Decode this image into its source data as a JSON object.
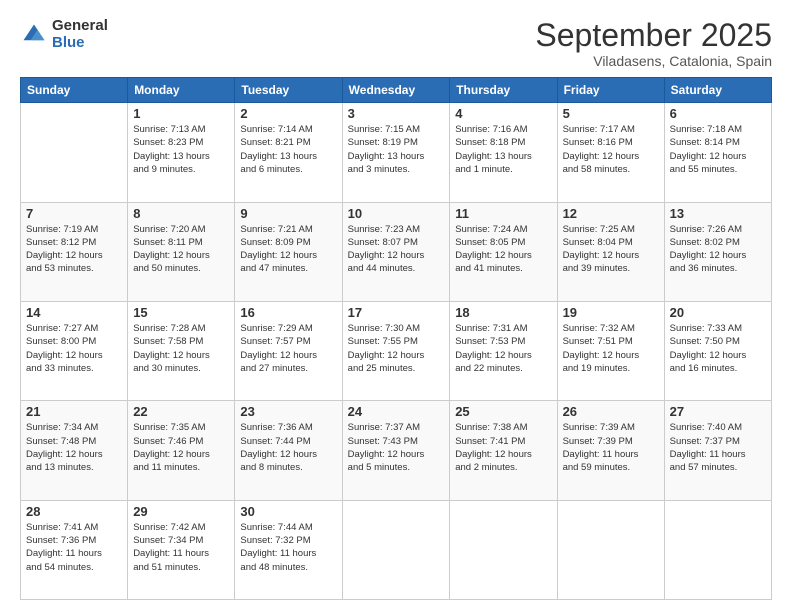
{
  "logo": {
    "general": "General",
    "blue": "Blue"
  },
  "title": "September 2025",
  "location": "Viladasens, Catalonia, Spain",
  "days_of_week": [
    "Sunday",
    "Monday",
    "Tuesday",
    "Wednesday",
    "Thursday",
    "Friday",
    "Saturday"
  ],
  "weeks": [
    [
      {
        "day": "",
        "info": ""
      },
      {
        "day": "1",
        "info": "Sunrise: 7:13 AM\nSunset: 8:23 PM\nDaylight: 13 hours\nand 9 minutes."
      },
      {
        "day": "2",
        "info": "Sunrise: 7:14 AM\nSunset: 8:21 PM\nDaylight: 13 hours\nand 6 minutes."
      },
      {
        "day": "3",
        "info": "Sunrise: 7:15 AM\nSunset: 8:19 PM\nDaylight: 13 hours\nand 3 minutes."
      },
      {
        "day": "4",
        "info": "Sunrise: 7:16 AM\nSunset: 8:18 PM\nDaylight: 13 hours\nand 1 minute."
      },
      {
        "day": "5",
        "info": "Sunrise: 7:17 AM\nSunset: 8:16 PM\nDaylight: 12 hours\nand 58 minutes."
      },
      {
        "day": "6",
        "info": "Sunrise: 7:18 AM\nSunset: 8:14 PM\nDaylight: 12 hours\nand 55 minutes."
      }
    ],
    [
      {
        "day": "7",
        "info": "Sunrise: 7:19 AM\nSunset: 8:12 PM\nDaylight: 12 hours\nand 53 minutes."
      },
      {
        "day": "8",
        "info": "Sunrise: 7:20 AM\nSunset: 8:11 PM\nDaylight: 12 hours\nand 50 minutes."
      },
      {
        "day": "9",
        "info": "Sunrise: 7:21 AM\nSunset: 8:09 PM\nDaylight: 12 hours\nand 47 minutes."
      },
      {
        "day": "10",
        "info": "Sunrise: 7:23 AM\nSunset: 8:07 PM\nDaylight: 12 hours\nand 44 minutes."
      },
      {
        "day": "11",
        "info": "Sunrise: 7:24 AM\nSunset: 8:05 PM\nDaylight: 12 hours\nand 41 minutes."
      },
      {
        "day": "12",
        "info": "Sunrise: 7:25 AM\nSunset: 8:04 PM\nDaylight: 12 hours\nand 39 minutes."
      },
      {
        "day": "13",
        "info": "Sunrise: 7:26 AM\nSunset: 8:02 PM\nDaylight: 12 hours\nand 36 minutes."
      }
    ],
    [
      {
        "day": "14",
        "info": "Sunrise: 7:27 AM\nSunset: 8:00 PM\nDaylight: 12 hours\nand 33 minutes."
      },
      {
        "day": "15",
        "info": "Sunrise: 7:28 AM\nSunset: 7:58 PM\nDaylight: 12 hours\nand 30 minutes."
      },
      {
        "day": "16",
        "info": "Sunrise: 7:29 AM\nSunset: 7:57 PM\nDaylight: 12 hours\nand 27 minutes."
      },
      {
        "day": "17",
        "info": "Sunrise: 7:30 AM\nSunset: 7:55 PM\nDaylight: 12 hours\nand 25 minutes."
      },
      {
        "day": "18",
        "info": "Sunrise: 7:31 AM\nSunset: 7:53 PM\nDaylight: 12 hours\nand 22 minutes."
      },
      {
        "day": "19",
        "info": "Sunrise: 7:32 AM\nSunset: 7:51 PM\nDaylight: 12 hours\nand 19 minutes."
      },
      {
        "day": "20",
        "info": "Sunrise: 7:33 AM\nSunset: 7:50 PM\nDaylight: 12 hours\nand 16 minutes."
      }
    ],
    [
      {
        "day": "21",
        "info": "Sunrise: 7:34 AM\nSunset: 7:48 PM\nDaylight: 12 hours\nand 13 minutes."
      },
      {
        "day": "22",
        "info": "Sunrise: 7:35 AM\nSunset: 7:46 PM\nDaylight: 12 hours\nand 11 minutes."
      },
      {
        "day": "23",
        "info": "Sunrise: 7:36 AM\nSunset: 7:44 PM\nDaylight: 12 hours\nand 8 minutes."
      },
      {
        "day": "24",
        "info": "Sunrise: 7:37 AM\nSunset: 7:43 PM\nDaylight: 12 hours\nand 5 minutes."
      },
      {
        "day": "25",
        "info": "Sunrise: 7:38 AM\nSunset: 7:41 PM\nDaylight: 12 hours\nand 2 minutes."
      },
      {
        "day": "26",
        "info": "Sunrise: 7:39 AM\nSunset: 7:39 PM\nDaylight: 11 hours\nand 59 minutes."
      },
      {
        "day": "27",
        "info": "Sunrise: 7:40 AM\nSunset: 7:37 PM\nDaylight: 11 hours\nand 57 minutes."
      }
    ],
    [
      {
        "day": "28",
        "info": "Sunrise: 7:41 AM\nSunset: 7:36 PM\nDaylight: 11 hours\nand 54 minutes."
      },
      {
        "day": "29",
        "info": "Sunrise: 7:42 AM\nSunset: 7:34 PM\nDaylight: 11 hours\nand 51 minutes."
      },
      {
        "day": "30",
        "info": "Sunrise: 7:44 AM\nSunset: 7:32 PM\nDaylight: 11 hours\nand 48 minutes."
      },
      {
        "day": "",
        "info": ""
      },
      {
        "day": "",
        "info": ""
      },
      {
        "day": "",
        "info": ""
      },
      {
        "day": "",
        "info": ""
      }
    ]
  ]
}
